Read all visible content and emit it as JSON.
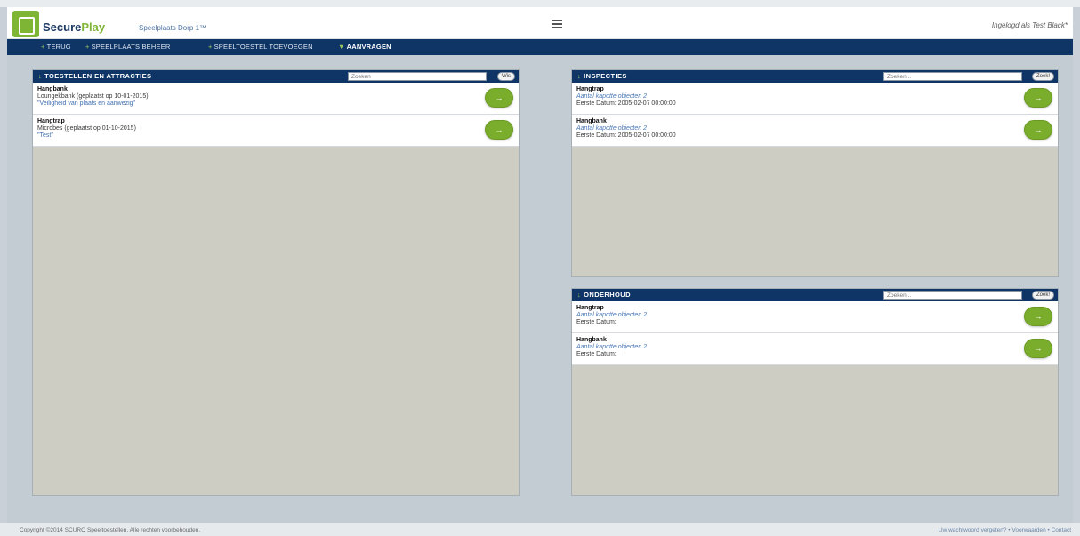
{
  "header": {
    "logo_secure": "Secure",
    "logo_play": "Play",
    "site_name": "Speelplaats Dorp 1™",
    "logged_in": "Ingelogd als Test Black*"
  },
  "nav": {
    "items": [
      {
        "label": "TERUG",
        "bullet": "+"
      },
      {
        "label": "SPEELPLAATS BEHEER",
        "bullet": "+"
      },
      {
        "label": "SPEELTOESTEL TOEVOEGEN",
        "bullet": "+"
      },
      {
        "label": "AANVRAGEN",
        "bullet": "▼"
      }
    ]
  },
  "panels": {
    "toestellen": {
      "title": "TOESTELLEN EN ATTRACTIES",
      "search_placeholder": "Zoeken",
      "search_button": "Wis",
      "items": [
        {
          "name": "Hangbank",
          "detail": "Loungekbank (geplaatst op 10-01-2015)",
          "note": "\"Veiligheid van plaats en aanwezig\""
        },
        {
          "name": "Hangtrap",
          "detail": "Microbes (geplaatst op 01-10-2015)",
          "note": "\"Test\""
        }
      ]
    },
    "inspecties": {
      "title": "INSPECTIES",
      "search_placeholder": "Zoeken...",
      "search_button": "Zoek!",
      "items": [
        {
          "name": "Hangtrap",
          "link": "Aantal kapotte objecten 2",
          "date": "Eerste Datum: 2005-02-07 00:00:00"
        },
        {
          "name": "Hangbank",
          "link": "Aantal kapotte objecten 2",
          "date": "Eerste Datum: 2005-02-07 00:00:00"
        }
      ]
    },
    "onderhoud": {
      "title": "ONDERHOUD",
      "search_placeholder": "Zoeken...",
      "search_button": "Zoek!",
      "items": [
        {
          "name": "Hangtrap",
          "link": "Aantal kapotte objecten 2",
          "date": "Eerste Datum:"
        },
        {
          "name": "Hangbank",
          "link": "Aantal kapotte objecten 2",
          "date": "Eerste Datum:"
        }
      ]
    }
  },
  "go_button_glyph": "→",
  "footer": {
    "copyright": "Copyright ©2014 SCURO Speeltoestellen. Alle rechten voorbehouden.",
    "links": [
      "Uw wachtwoord vergeten?",
      "Voorwaarden",
      "Contact"
    ],
    "separator": " • "
  },
  "colors": {
    "nav_bg": "#0e3566",
    "accent_green": "#7aad2c",
    "panel_bg": "#cdcdc4",
    "page_bg": "#c3cbd3"
  }
}
